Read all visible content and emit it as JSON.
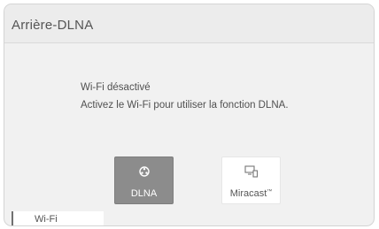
{
  "header": {
    "title": "Arrière-DLNA"
  },
  "message": {
    "line1": "Wi-Fi désactivé",
    "line2": "Activez le Wi-Fi pour utiliser la fonction DLNA."
  },
  "buttons": {
    "dlna": {
      "label": "DLNA",
      "icon": "dlna-network-icon",
      "state": "selected"
    },
    "miracast": {
      "label": "Miracast",
      "trademark": "™",
      "icon": "screen-cast-icon"
    }
  },
  "footer": {
    "wifi_label": "Wi-Fi"
  },
  "colors": {
    "selected_button": "#8c8c8c",
    "background": "#f1f1f1",
    "text": "#4a4a4a"
  }
}
